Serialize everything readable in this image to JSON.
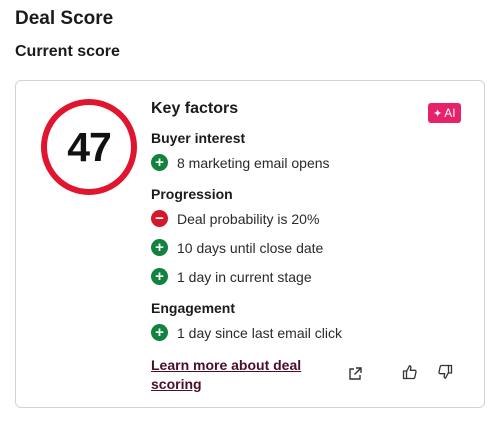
{
  "header": {
    "title": "Deal Score",
    "subtitle": "Current score"
  },
  "score": {
    "value": "47",
    "ring_color": "#e0152f"
  },
  "factors": {
    "title": "Key factors",
    "ai_badge": "AI",
    "groups": [
      {
        "title": "Buyer interest",
        "items": [
          {
            "type": "positive",
            "text": "8 marketing email opens"
          }
        ]
      },
      {
        "title": "Progression",
        "items": [
          {
            "type": "negative",
            "text": "Deal probability is 20%"
          },
          {
            "type": "positive",
            "text": "10 days until close date"
          },
          {
            "type": "positive",
            "text": "1 day in current stage"
          }
        ]
      },
      {
        "title": "Engagement",
        "items": [
          {
            "type": "positive",
            "text": "1 day since last email click"
          }
        ]
      }
    ]
  },
  "footer": {
    "learn_more": "Learn more about deal scoring"
  },
  "colors": {
    "positive": "#12833f",
    "negative": "#d4172b",
    "ai_badge": "#e5226a",
    "link": "#4a0d2a"
  },
  "icons": {
    "external": "external-link-icon",
    "thumbs_up": "thumbs-up-icon",
    "thumbs_down": "thumbs-down-icon"
  }
}
